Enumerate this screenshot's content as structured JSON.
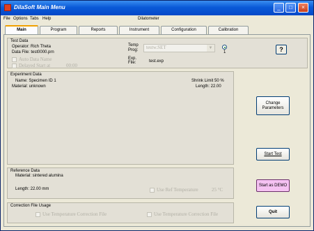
{
  "window": {
    "title": "DilaSoft Main Menu"
  },
  "menu": {
    "items": [
      "File",
      "Options",
      "Tabs",
      "Help"
    ],
    "center_label": "Dilatometer"
  },
  "tabs": [
    "Main",
    "Program",
    "Reports",
    "Instrument",
    "Configuration",
    "Calibration"
  ],
  "active_tab": "Main",
  "test_data": {
    "title": "Test Data",
    "operator": "Operator: Rich Theta",
    "data_file": "Data File: test0000.prn",
    "auto_data_name": "Auto Data Name",
    "delayed_start": "Delayed Start at",
    "delayed_time": "00:00",
    "temp_prog_label1": "Temp",
    "temp_prog_label2": "Prog:",
    "temp_prog_value": "testw.SET",
    "exp_label1": "Exp.",
    "exp_label2": "File:",
    "exp_value": "test.exp",
    "radio_value": "1"
  },
  "experiment_data": {
    "title": "Experiment Data",
    "name": "Name: Specimen ID 1",
    "material": "Material: unknown",
    "shrink_limit": "Shrink Limit 50 %",
    "length": "Length: 22.00"
  },
  "reference_data": {
    "title": "Reference Data",
    "material": "Material:   sintered alumina",
    "length": "Length: 22.00 mm",
    "use_ref_temp": "Use Ref Temperature",
    "ref_temp": "25 °C"
  },
  "correction": {
    "title": "Correction File Usage",
    "option1": "Use Temperature Correction File",
    "option2": "Use Temperature Correction File"
  },
  "buttons": {
    "help": "?",
    "change_parameters": "Change Parameters",
    "start_test": "Start Test",
    "start_demo": "Start as DEMO",
    "quit": "Quit"
  }
}
